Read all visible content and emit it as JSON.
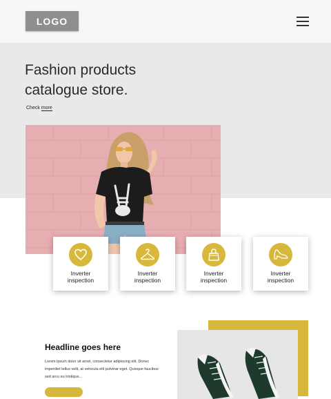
{
  "header": {
    "logo_text": "LOGO",
    "menu_icon": "hamburger-menu-icon"
  },
  "hero": {
    "title_line1": "Fashion products",
    "title_line2": "catalogue store.",
    "check_prefix": "Check",
    "check_link": "more"
  },
  "features": [
    {
      "icon": "heart-icon",
      "label_line1": "Inverter",
      "label_line2": "inspection"
    },
    {
      "icon": "hanger-icon",
      "label_line1": "Inverter",
      "label_line2": "inspection"
    },
    {
      "icon": "shopping-bag-icon",
      "label_line1": "Inverter",
      "label_line2": "inspection"
    },
    {
      "icon": "high-heel-icon",
      "label_line1": "Inverter",
      "label_line2": "inspection"
    }
  ],
  "section": {
    "headline": "Headline goes here",
    "body_line1": "Lorem ipsum dolor sit amet, consectetur adipiscing elit. Donec",
    "body_line2": "imperdiet tellus velit, at vehicula elit pulvinar eget. Quisque faucibus",
    "body_line3": "sed arcu eu tristique..."
  },
  "colors": {
    "accent": "#d8b83b",
    "hero_bg": "#e9e9e9",
    "header_bg": "#f7f7f7",
    "logo_bg": "#8f8f8f",
    "photo_pink": "#e7aeb1"
  }
}
